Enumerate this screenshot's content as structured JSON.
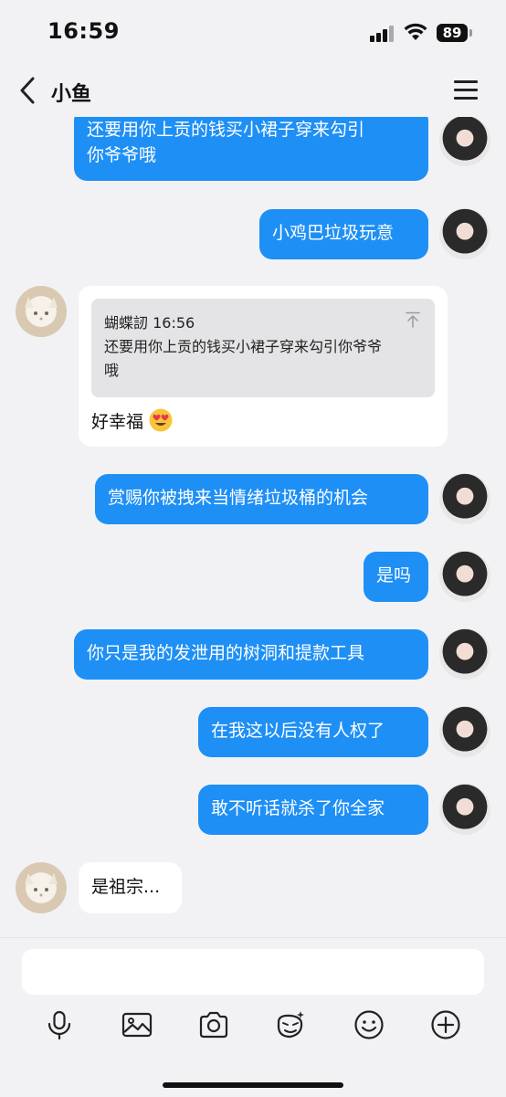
{
  "status_bar": {
    "time": "16:59",
    "battery": "89"
  },
  "nav": {
    "title": "小鱼"
  },
  "messages": [
    {
      "side": "out",
      "text_line1": "还要用你上贡的钱买小裙子穿来勾引",
      "text_line2": "你爷爷哦"
    },
    {
      "side": "out",
      "text": "小鸡巴垃圾玩意"
    },
    {
      "side": "in",
      "quote_sender": "蝴蝶訒",
      "quote_time": "16:56",
      "quote_line1": "还要用你上贡的钱买小裙子穿来勾引你爷爷",
      "quote_line2": "哦",
      "text": "好幸福",
      "emoji": "heart-eyes"
    },
    {
      "side": "out",
      "text": "赏赐你被拽来当情绪垃圾桶的机会"
    },
    {
      "side": "out",
      "text": "是吗"
    },
    {
      "side": "out",
      "text": "你只是我的发泄用的树洞和提款工具"
    },
    {
      "side": "out",
      "text": "在我这以后没有人权了"
    },
    {
      "side": "out",
      "text": "敢不听话就杀了你全家"
    },
    {
      "side": "in",
      "text": "是祖宗..."
    }
  ],
  "toolbar": [
    "microphone-icon",
    "image-icon",
    "camera-icon",
    "sticker-icon",
    "smiley-icon",
    "plus-icon"
  ],
  "colors": {
    "outgoing": "#1e8ff5",
    "background": "#f2f2f4"
  }
}
